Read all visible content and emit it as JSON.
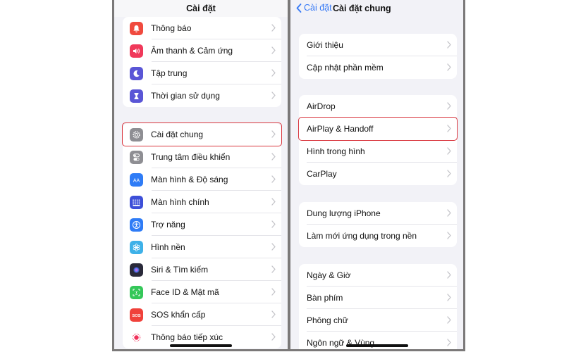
{
  "left": {
    "title": "Cài đặt",
    "groups": [
      {
        "items": [
          {
            "label": "Thông báo",
            "icon": "bell-icon",
            "color": "#f04a3e"
          },
          {
            "label": "Âm thanh & Cảm ứng",
            "icon": "speaker-icon",
            "color": "#f0395a"
          },
          {
            "label": "Tập trung",
            "icon": "moon-icon",
            "color": "#5a56d6"
          },
          {
            "label": "Thời gian sử dụng",
            "icon": "hourglass-icon",
            "color": "#5a56d6"
          }
        ]
      },
      {
        "items": [
          {
            "label": "Cài đặt chung",
            "icon": "gear-icon",
            "color": "#8e8e93",
            "highlighted": true
          },
          {
            "label": "Trung tâm điều khiển",
            "icon": "toggles-icon",
            "color": "#8e8e93"
          },
          {
            "label": "Màn hình & Độ sáng",
            "icon": "text-size-icon",
            "color": "#2f7cf6"
          },
          {
            "label": "Màn hình chính",
            "icon": "app-grid-icon",
            "color": "#3d4fd8"
          },
          {
            "label": "Trợ năng",
            "icon": "accessibility-icon",
            "color": "#2f7cf6"
          },
          {
            "label": "Hình nền",
            "icon": "flower-icon",
            "color": "#3eb1e8"
          },
          {
            "label": "Siri & Tìm kiếm",
            "icon": "siri-icon",
            "color": "#2a2a3a"
          },
          {
            "label": "Face ID & Mật mã",
            "icon": "face-id-icon",
            "color": "#34c759"
          },
          {
            "label": "SOS khẩn cấp",
            "icon": "sos-icon",
            "color": "#f0413a",
            "icon_text": "SOS"
          },
          {
            "label": "Thông báo tiếp xúc",
            "icon": "exposure-icon",
            "color": "#ffffff"
          }
        ]
      }
    ]
  },
  "right": {
    "back_label": "Cài đặt",
    "title": "Cài đặt chung",
    "groups": [
      {
        "items": [
          {
            "label": "Giới thiệu"
          },
          {
            "label": "Cập nhật phần mềm"
          }
        ]
      },
      {
        "items": [
          {
            "label": "AirDrop"
          },
          {
            "label": "AirPlay & Handoff",
            "highlighted": true
          },
          {
            "label": "Hình trong hình"
          },
          {
            "label": "CarPlay"
          }
        ]
      },
      {
        "items": [
          {
            "label": "Dung lượng iPhone"
          },
          {
            "label": "Làm mới ứng dụng trong nền"
          }
        ]
      },
      {
        "items": [
          {
            "label": "Ngày & Giờ"
          },
          {
            "label": "Bàn phím"
          },
          {
            "label": "Phông chữ"
          },
          {
            "label": "Ngôn ngữ & Vùng"
          }
        ]
      }
    ]
  },
  "highlight_color": "#d9363e",
  "accent_color": "#3478f6"
}
